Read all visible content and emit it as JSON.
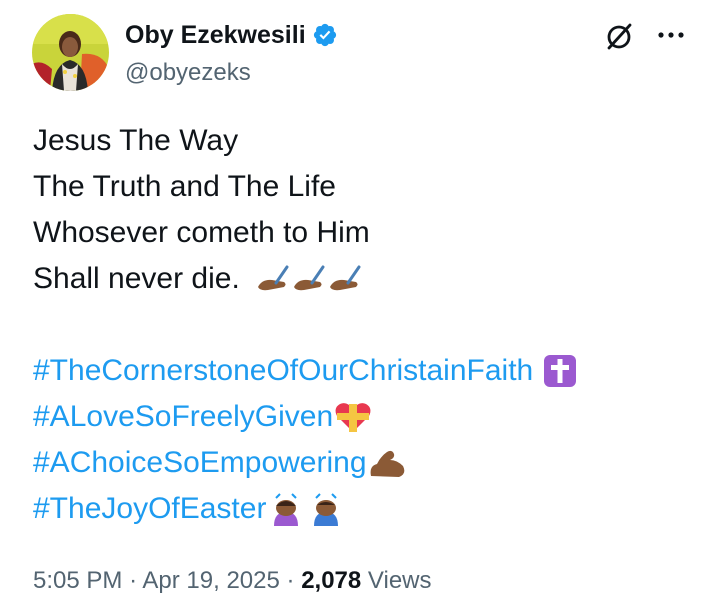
{
  "author": {
    "name": "Oby Ezekwesili",
    "handle": "@obyezeks",
    "verified": true,
    "avatar_icon": "avatar"
  },
  "actions": {
    "grok_icon": "grok-icon",
    "more_icon": "more-icon"
  },
  "tweet": {
    "lines": [
      "Jesus The Way",
      "The Truth and The Life",
      "Whosever cometh to Him",
      "Shall never die."
    ],
    "hashtags": [
      "#TheCornerstoneOfOurChristainFaith",
      "#ALoveSoFreelyGiven",
      "#AChoiceSoEmpowering",
      "#TheJoyOfEaster"
    ]
  },
  "meta": {
    "time": "5:05 PM",
    "separator": "·",
    "date": "Apr 19, 2025",
    "views_count": "2,078",
    "views_label": "Views"
  },
  "colors": {
    "text": "#0f1419",
    "secondary": "#536471",
    "link": "#1d9bf0",
    "verified": "#1d9bf0"
  }
}
